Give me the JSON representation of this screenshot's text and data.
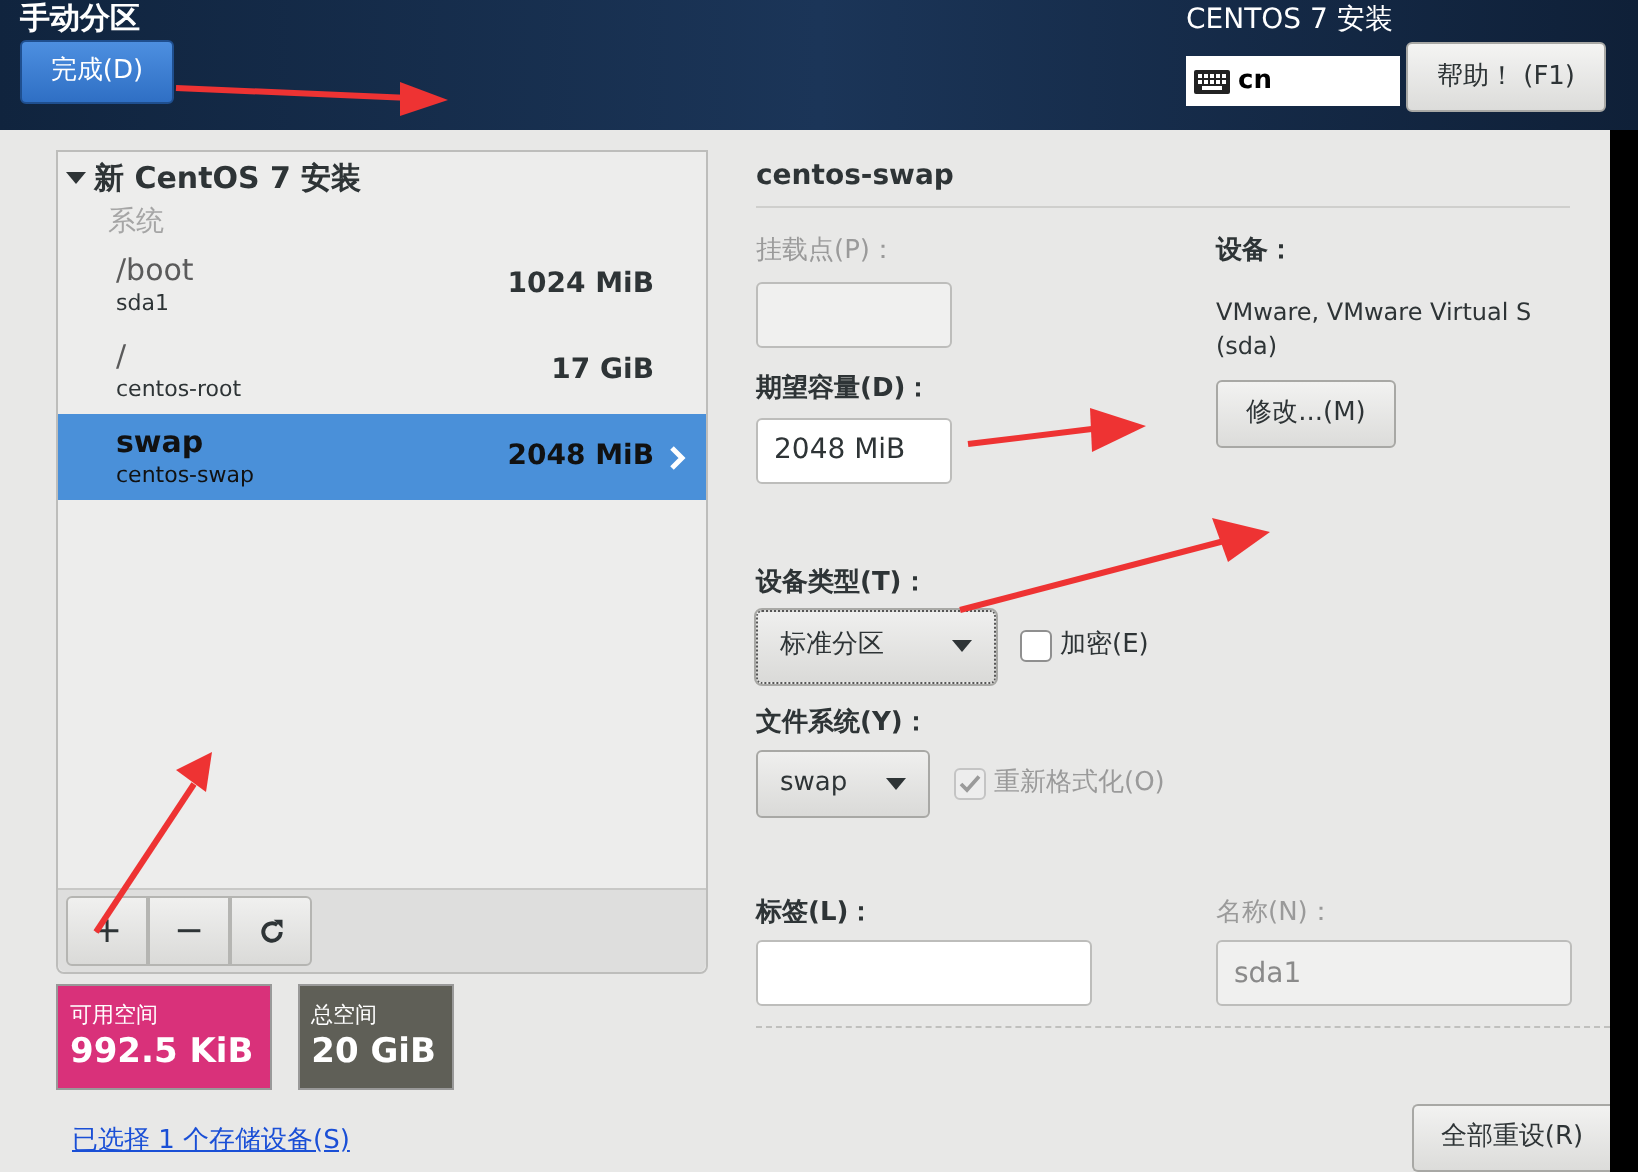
{
  "header": {
    "title": "手动分区",
    "done_button": "完成(D)",
    "product": "CENTOS 7 安装",
    "keyboard": {
      "value": "cn"
    },
    "help_button": "帮助！ (F1)"
  },
  "partitions": {
    "group": {
      "title": "新 CentOS 7 安装",
      "expanded": true
    },
    "section": "系统",
    "items": [
      {
        "mount": "/boot",
        "device": "sda1",
        "size": "1024 MiB",
        "selected": false
      },
      {
        "mount": "/",
        "device": "centos-root",
        "size": "17 GiB",
        "selected": false
      },
      {
        "mount": "swap",
        "device": "centos-swap",
        "size": "2048 MiB",
        "selected": true
      }
    ],
    "toolbar": [
      {
        "kind": "add",
        "label": "+"
      },
      {
        "kind": "remove",
        "label": "−"
      },
      {
        "kind": "refresh"
      }
    ]
  },
  "space": [
    {
      "label": "可用空间",
      "value": "992.5 KiB",
      "color": "#d9317a"
    },
    {
      "label": "总空间",
      "value": "20 GiB",
      "color": "#5f5f57"
    }
  ],
  "storage_link": "已选择 1 个存储设备(S)",
  "details": {
    "title": "centos-swap",
    "mount_point": {
      "label": "挂载点(P)：",
      "disabled": true
    },
    "capacity": {
      "label": "期望容量(D)：",
      "value": "2048 MiB",
      "disabled": false
    },
    "device": {
      "label": "设备：",
      "lines": [
        "VMware, VMware Virtual S",
        "(sda)"
      ],
      "button": "修改...(M)"
    },
    "device_type": {
      "label": "设备类型(T)：",
      "value": "标准分区",
      "focused": true,
      "checkbox": {
        "label": "加密(E)",
        "checked": false,
        "disabled": false
      }
    },
    "filesystem": {
      "label": "文件系统(Y)：",
      "value": "swap",
      "checkbox": {
        "label": "重新格式化(O)",
        "checked": true,
        "disabled": true
      }
    },
    "tag": {
      "label": "标签(L)：",
      "disabled": false
    },
    "name": {
      "label": "名称(N)：",
      "value": "sda1",
      "disabled": true
    }
  },
  "reset_button": "全部重设(R)"
}
